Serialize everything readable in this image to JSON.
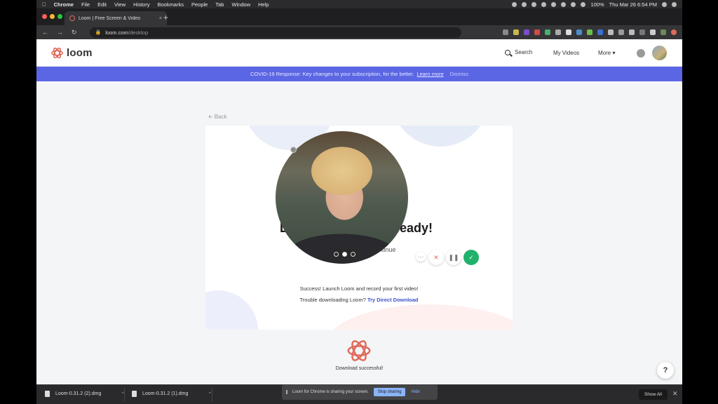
{
  "menubar": {
    "apple_icon": "apple-icon",
    "app": "Chrome",
    "items": [
      "File",
      "Edit",
      "View",
      "History",
      "Bookmarks",
      "People",
      "Tab",
      "Window",
      "Help"
    ],
    "battery": "100%",
    "clock": "Thu Mar 26  6:54 PM"
  },
  "browser": {
    "tab_title": "Loom | Free Screen & Video",
    "tab_close": "×",
    "new_tab": "+",
    "url_host": "loom.com",
    "url_path": "/desktop"
  },
  "header": {
    "logo_text": "loom",
    "search_label": "Search",
    "my_videos": "My Videos",
    "more": "More ▾"
  },
  "banner": {
    "text": "COVID-19 Response: Key changes to your subscription, for the better.",
    "link": "Learn more",
    "dismiss": "Dismiss"
  },
  "content": {
    "back": "Back",
    "title_start": "D",
    "title_end": "ready!",
    "subtitle_fragment": "o continue",
    "success_text": "Success! Launch Loom and record your first video!",
    "trouble_text": "Trouble downloading Loom?",
    "trouble_link": "Try Direct Download",
    "download_status": "Download successful!",
    "help": "?"
  },
  "recorder": {
    "more": "···",
    "cancel": "✕",
    "pause": "❚❚",
    "done": "✓"
  },
  "shelf": {
    "downloads": [
      "Loom-0.31.2 (2).dmg",
      "Loom-0.31.2 (1).dmg"
    ],
    "show_all": "Show All",
    "close": "✕"
  },
  "sharing": {
    "message": "Loom for Chrome is sharing your screen.",
    "stop": "Stop sharing",
    "hide": "Hide"
  },
  "colors": {
    "banner": "#5b66e4",
    "brand": "#e06a5a",
    "done": "#20b26b",
    "link": "#3a52c7"
  }
}
